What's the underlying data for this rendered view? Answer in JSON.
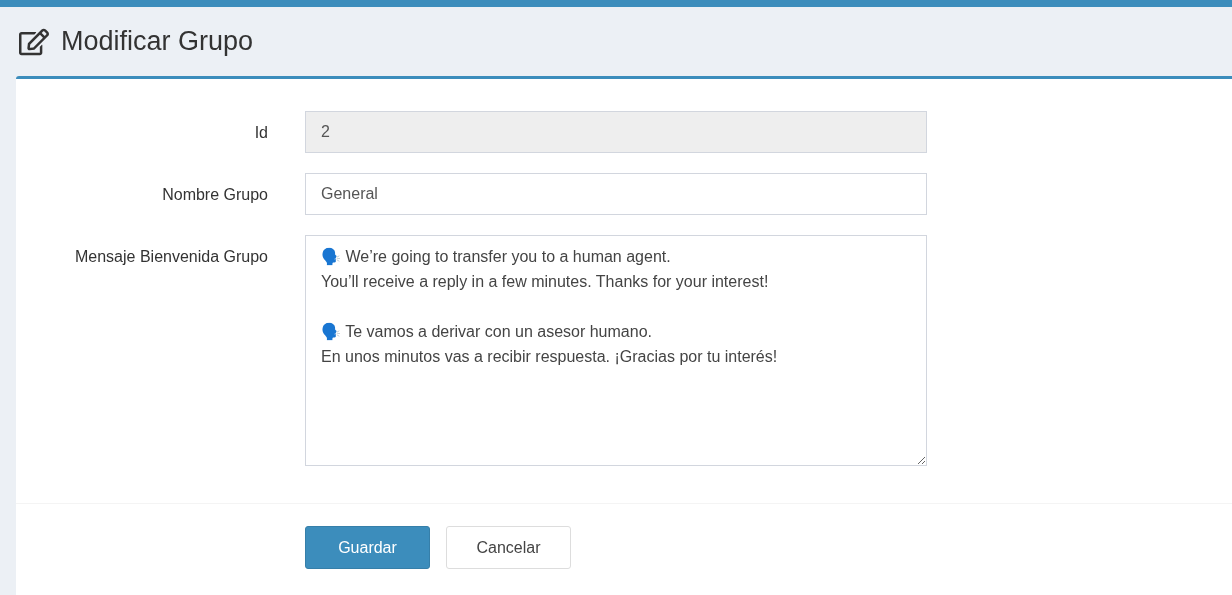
{
  "page_title": "Modificar Grupo",
  "fields": [
    {
      "label": "Id",
      "kind": "text",
      "value": "2",
      "disabled": true
    },
    {
      "label": "Nombre Grupo",
      "kind": "text",
      "value": "General",
      "disabled": false
    },
    {
      "label": "Mensaje Bienvenida Grupo",
      "kind": "textarea",
      "value": "🗣️ We’re going to transfer you to a human agent.\nYou’ll receive a reply in a few minutes. Thanks for your interest!\n\n🗣️ Te vamos a derivar con un asesor humano.\nEn unos minutos vas a recibir respuesta. ¡Gracias por tu interés!",
      "disabled": false
    }
  ],
  "buttons": [
    {
      "label": "Guardar",
      "kind": "primary"
    },
    {
      "label": "Cancelar",
      "kind": "default"
    }
  ]
}
